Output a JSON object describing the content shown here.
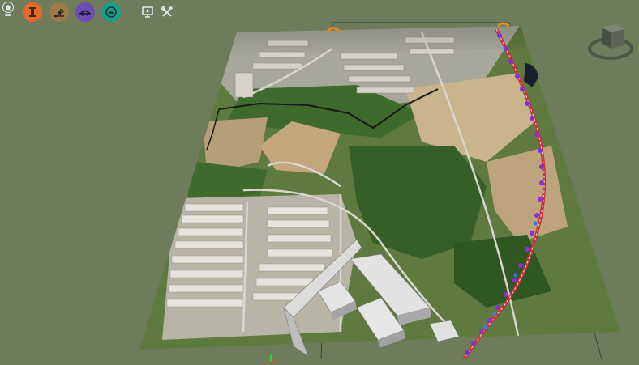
{
  "toolbar": {
    "tools": [
      {
        "name": "home",
        "icon": "home-icon"
      },
      {
        "name": "measure",
        "icon": "ruler-icon",
        "color": "#e56a2a"
      },
      {
        "name": "terrain",
        "icon": "excavator-icon",
        "color": "#9c7a4c"
      },
      {
        "name": "bridge",
        "icon": "bridge-icon",
        "color": "#6b4fb0"
      },
      {
        "name": "underground",
        "icon": "tunnel-icon",
        "color": "#1e9c8c"
      },
      {
        "name": "display",
        "icon": "monitor-icon"
      },
      {
        "name": "settings",
        "icon": "tools-icon"
      }
    ]
  },
  "colors": {
    "background": "#6f7c5c",
    "road": "#d9d6d0",
    "vegetation": "#3f6b2e",
    "cleared_land": "#c9b38a",
    "railway_line": "#c7323e",
    "railway_markers": "#8a2fd0"
  },
  "scene": {
    "model": "terrain-map-3d",
    "navigation": "view-cube"
  }
}
